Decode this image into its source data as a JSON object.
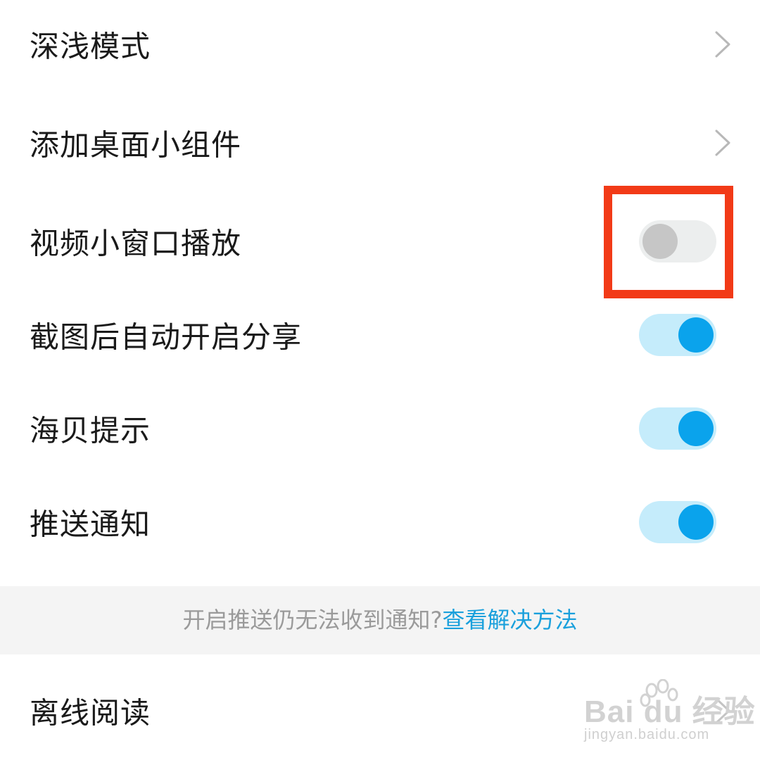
{
  "settings": {
    "items": [
      {
        "label": "深浅模式",
        "control": "chevron"
      },
      {
        "label": "添加桌面小组件",
        "control": "chevron"
      },
      {
        "label": "视频小窗口播放",
        "control": "toggle",
        "state": "off"
      },
      {
        "label": "截图后自动开启分享",
        "control": "toggle",
        "state": "on"
      },
      {
        "label": "海贝提示",
        "control": "toggle",
        "state": "on"
      },
      {
        "label": "推送通知",
        "control": "toggle",
        "state": "on"
      }
    ],
    "notice": {
      "text": "开启推送仍无法收到通知?",
      "link": "查看解决方法"
    },
    "last_item": {
      "label": "离线阅读",
      "control": "chevron"
    }
  },
  "watermark": {
    "logo": "Bai du 经验",
    "url": "jingyan.baidu.com"
  },
  "colors": {
    "toggle_on_track": "#c5ecfb",
    "toggle_on_knob": "#0aa3ec",
    "toggle_off_track": "#eceeee",
    "toggle_off_knob": "#c6c6c6",
    "highlight": "#f23a17",
    "link": "#1aa0dc"
  }
}
